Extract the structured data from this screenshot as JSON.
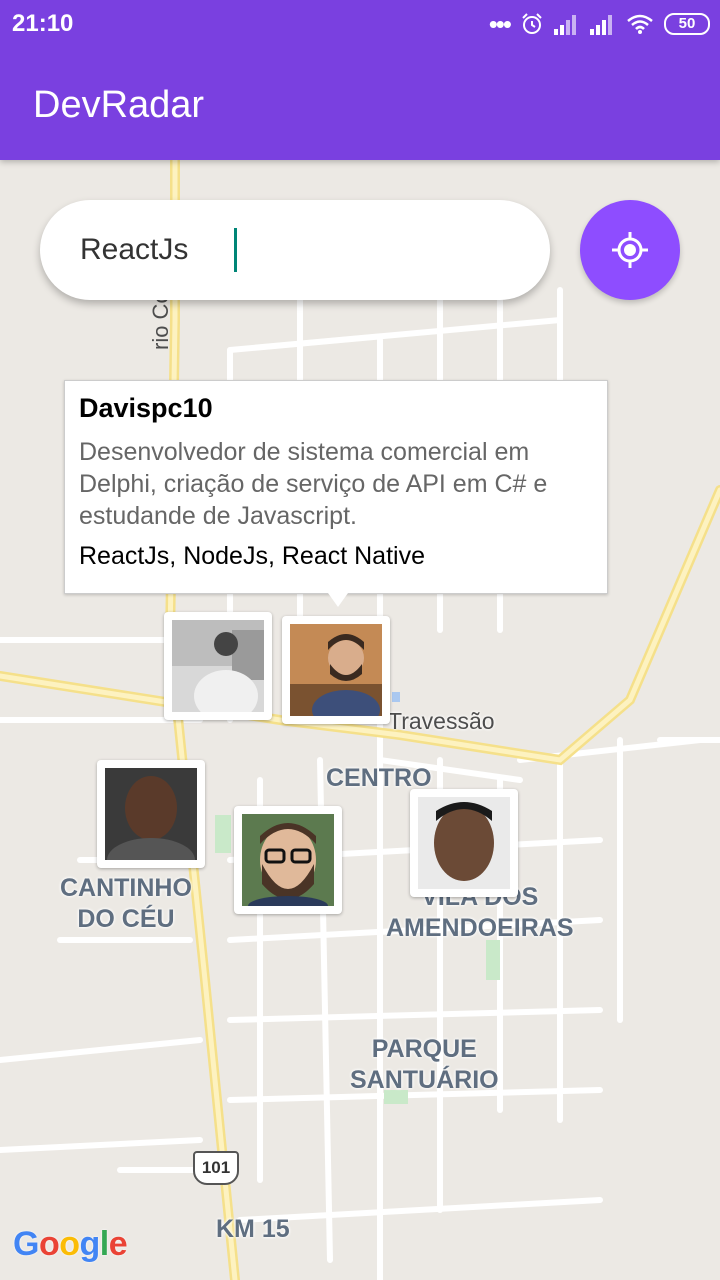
{
  "status_bar": {
    "time": "21:10",
    "icons": [
      "more-dots-icon",
      "alarm-icon",
      "signal-icon",
      "signal-icon",
      "wifi-icon"
    ],
    "battery": "50"
  },
  "app_bar": {
    "title": "DevRadar"
  },
  "search": {
    "value": "ReactJs",
    "placeholder": ""
  },
  "locate_button": {
    "icon": "my-location-icon"
  },
  "callout": {
    "name": "Davispc10",
    "bio": "Desenvolvedor de sistema comercial em Delphi, criação de serviço de API em C# e estudande de Javascript.",
    "techs": "ReactJs, NodeJs, React Native"
  },
  "map": {
    "labels": {
      "travessao": "Travessão",
      "centro": "CENTRO",
      "cantinho": "CANTINHO\nDO CÉU",
      "vila_dos": "VILA DOS\nAMENDOEIRAS",
      "parque": "PARQUE\nSANTUÁRIO",
      "km15": "KM 15",
      "street": "rio Covas"
    },
    "road_shield": "101",
    "logo": "Google"
  },
  "colors": {
    "primary": "#7a40e0",
    "fab": "#8e4dff",
    "caret": "#008577"
  }
}
